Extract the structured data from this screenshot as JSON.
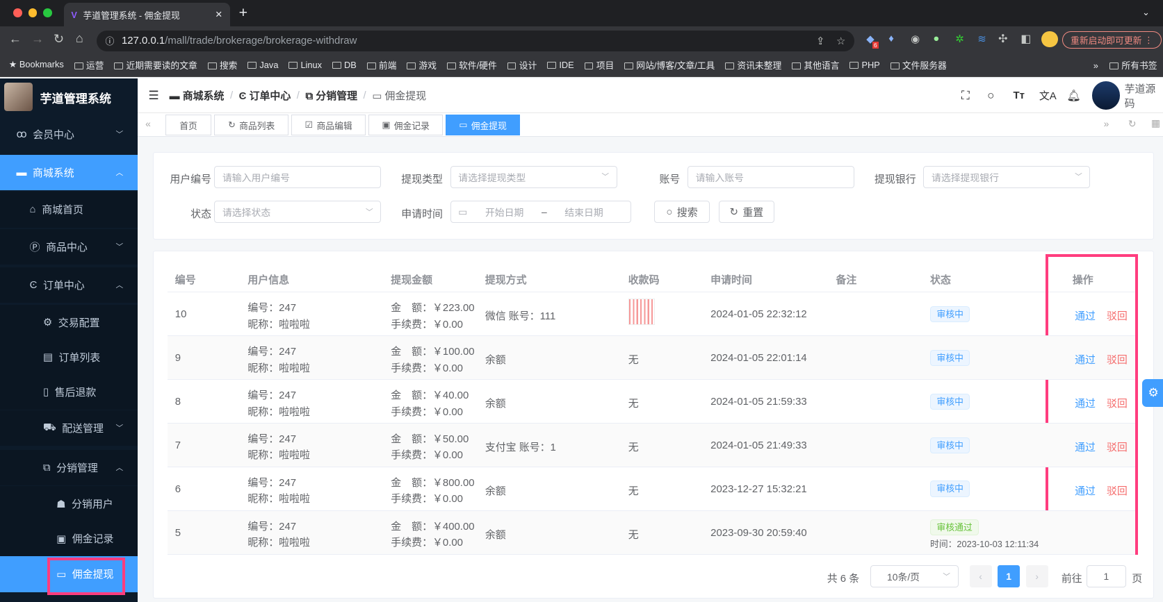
{
  "browser": {
    "tab_title": "芋道管理系统 - 佣金提现",
    "url_host": "127.0.0.1",
    "url_path": "/mall/trade/brokerage/brokerage-withdraw",
    "update_button": "重新启动即可更新",
    "extension_badge": "6",
    "bookmarks": [
      "Bookmarks",
      "运营",
      "近期需要读的文章",
      "搜索",
      "Java",
      "Linux",
      "DB",
      "前端",
      "游戏",
      "软件/硬件",
      "设计",
      "IDE",
      "项目",
      "网站/博客/文章/工具",
      "资讯未整理",
      "其他语言",
      "PHP",
      "文件服务器"
    ],
    "all_bookmarks": "所有书签"
  },
  "app": {
    "title": "芋道管理系统",
    "user": "芋道源码",
    "accent": "#409eff"
  },
  "breadcrumb": [
    "商城系统",
    "订单中心",
    "分销管理",
    "佣金提现"
  ],
  "sidebar": [
    {
      "label": "会员中心",
      "icon": "bike-icon",
      "level": 0,
      "chev": "down"
    },
    {
      "label": "商城系统",
      "icon": "store-icon",
      "level": 0,
      "chev": "up",
      "highlight": true
    },
    {
      "label": "商城首页",
      "icon": "home-icon",
      "level": 1
    },
    {
      "label": "商品中心",
      "icon": "product-icon",
      "level": 1,
      "chev": "down"
    },
    {
      "label": "订单中心",
      "icon": "order-icon",
      "level": 1,
      "chev": "up"
    },
    {
      "label": "交易配置",
      "icon": "gear-icon",
      "level": 2
    },
    {
      "label": "订单列表",
      "icon": "list-icon",
      "level": 2
    },
    {
      "label": "售后退款",
      "icon": "refund-icon",
      "level": 2
    },
    {
      "label": "配送管理",
      "icon": "cart-icon",
      "level": 2,
      "chev": "down"
    },
    {
      "label": "分销管理",
      "icon": "network-icon",
      "level": 2,
      "chev": "up"
    },
    {
      "label": "分销用户",
      "icon": "user-icon",
      "level": 3
    },
    {
      "label": "佣金记录",
      "icon": "money-icon",
      "level": 3
    },
    {
      "label": "佣金提现",
      "icon": "card-icon",
      "level": 3,
      "active": true
    }
  ],
  "tabs": [
    "首页",
    "商品列表",
    "商品编辑",
    "佣金记录",
    "佣金提现"
  ],
  "search": {
    "user_id_label": "用户编号",
    "user_id_ph": "请输入用户编号",
    "type_label": "提现类型",
    "type_ph": "请选择提现类型",
    "account_label": "账号",
    "account_ph": "请输入账号",
    "bank_label": "提现银行",
    "bank_ph": "请选择提现银行",
    "status_label": "状态",
    "status_ph": "请选择状态",
    "time_label": "申请时间",
    "start_ph": "开始日期",
    "sep": "–",
    "end_ph": "结束日期",
    "search_btn": "搜索",
    "reset_btn": "重置"
  },
  "table": {
    "headers": [
      "编号",
      "用户信息",
      "提现金额",
      "提现方式",
      "收款码",
      "申请时间",
      "备注",
      "状态",
      "操作"
    ],
    "rows": [
      {
        "id": "10",
        "uid": "编号：247",
        "nick": "昵称：啦啦啦",
        "amount": "金　额：￥223.00",
        "fee": "手续费：￥0.00",
        "method": "微信 账号：111",
        "qr": "",
        "time": "2024-01-05 22:32:12",
        "status": "审核中",
        "pass": "通过",
        "reject": "驳回"
      },
      {
        "id": "9",
        "uid": "编号：247",
        "nick": "昵称：啦啦啦",
        "amount": "金　额：￥100.00",
        "fee": "手续费：￥0.00",
        "method": "余额",
        "qr": "无",
        "time": "2024-01-05 22:01:14",
        "status": "审核中",
        "pass": "通过",
        "reject": "驳回"
      },
      {
        "id": "8",
        "uid": "编号：247",
        "nick": "昵称：啦啦啦",
        "amount": "金　额：￥40.00",
        "fee": "手续费：￥0.00",
        "method": "余额",
        "qr": "无",
        "time": "2024-01-05 21:59:33",
        "status": "审核中",
        "pass": "通过",
        "reject": "驳回"
      },
      {
        "id": "7",
        "uid": "编号：247",
        "nick": "昵称：啦啦啦",
        "amount": "金　额：￥50.00",
        "fee": "手续费：￥0.00",
        "method": "支付宝 账号：1",
        "qr": "无",
        "time": "2024-01-05 21:49:33",
        "status": "审核中",
        "pass": "通过",
        "reject": "驳回"
      },
      {
        "id": "6",
        "uid": "编号：247",
        "nick": "昵称：啦啦啦",
        "amount": "金　额：￥800.00",
        "fee": "手续费：￥0.00",
        "method": "余额",
        "qr": "无",
        "time": "2023-12-27 15:32:21",
        "status": "审核中",
        "pass": "通过",
        "reject": "驳回"
      },
      {
        "id": "5",
        "uid": "编号：247",
        "nick": "昵称：啦啦啦",
        "amount": "金　额：￥400.00",
        "fee": "手续费：￥0.00",
        "method": "余额",
        "qr": "无",
        "time": "2023-09-30 20:59:40",
        "status": "审核通过",
        "status_time": "时间：2023-10-03 12:11:34"
      }
    ]
  },
  "pagination": {
    "total": "共 6 条",
    "page_size": "10条/页",
    "current": "1",
    "goto_label": "前往",
    "goto_value": "1",
    "page_suffix": "页"
  }
}
